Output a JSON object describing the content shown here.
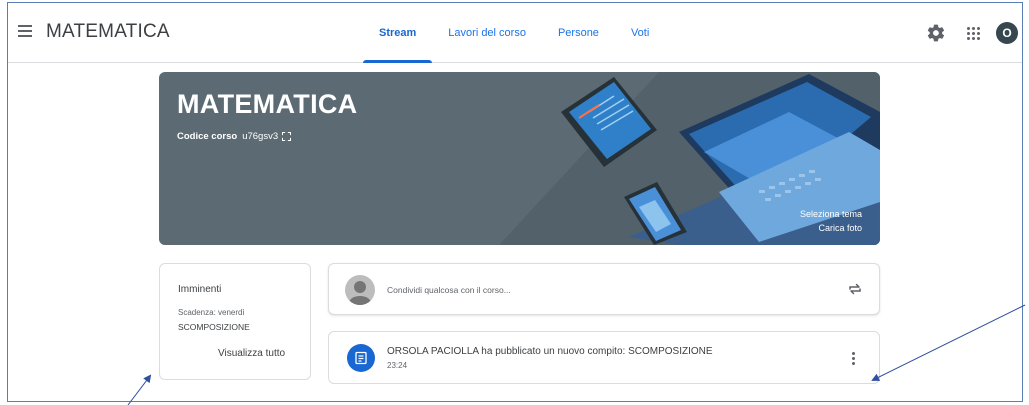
{
  "header": {
    "app_title": "MATEMATICA",
    "tabs": [
      {
        "label": "Stream",
        "active": true
      },
      {
        "label": "Lavori del corso",
        "active": false
      },
      {
        "label": "Persone",
        "active": false
      },
      {
        "label": "Voti",
        "active": false
      }
    ],
    "avatar_initial": "O",
    "icons": [
      "menu-icon",
      "gear-icon",
      "apps-grid-icon"
    ]
  },
  "banner": {
    "title": "MATEMATICA",
    "code_label": "Codice corso",
    "code_value": "u76gsv3",
    "select_theme": "Seleziona tema",
    "upload_photo": "Carica foto"
  },
  "upcoming": {
    "title": "Imminenti",
    "due": "Scadenza: venerdì",
    "item": "SCOMPOSIZIONE",
    "view_all": "Visualizza tutto"
  },
  "share": {
    "placeholder": "Condividi qualcosa con il corso..."
  },
  "post": {
    "title": "ORSOLA PACIOLLA ha pubblicato un nuovo compito: SCOMPOSIZIONE",
    "time": "23:24"
  },
  "colors": {
    "accent": "#1967d2",
    "banner": "#5c6b73",
    "annotation_arrow": "#2f4fa0"
  }
}
